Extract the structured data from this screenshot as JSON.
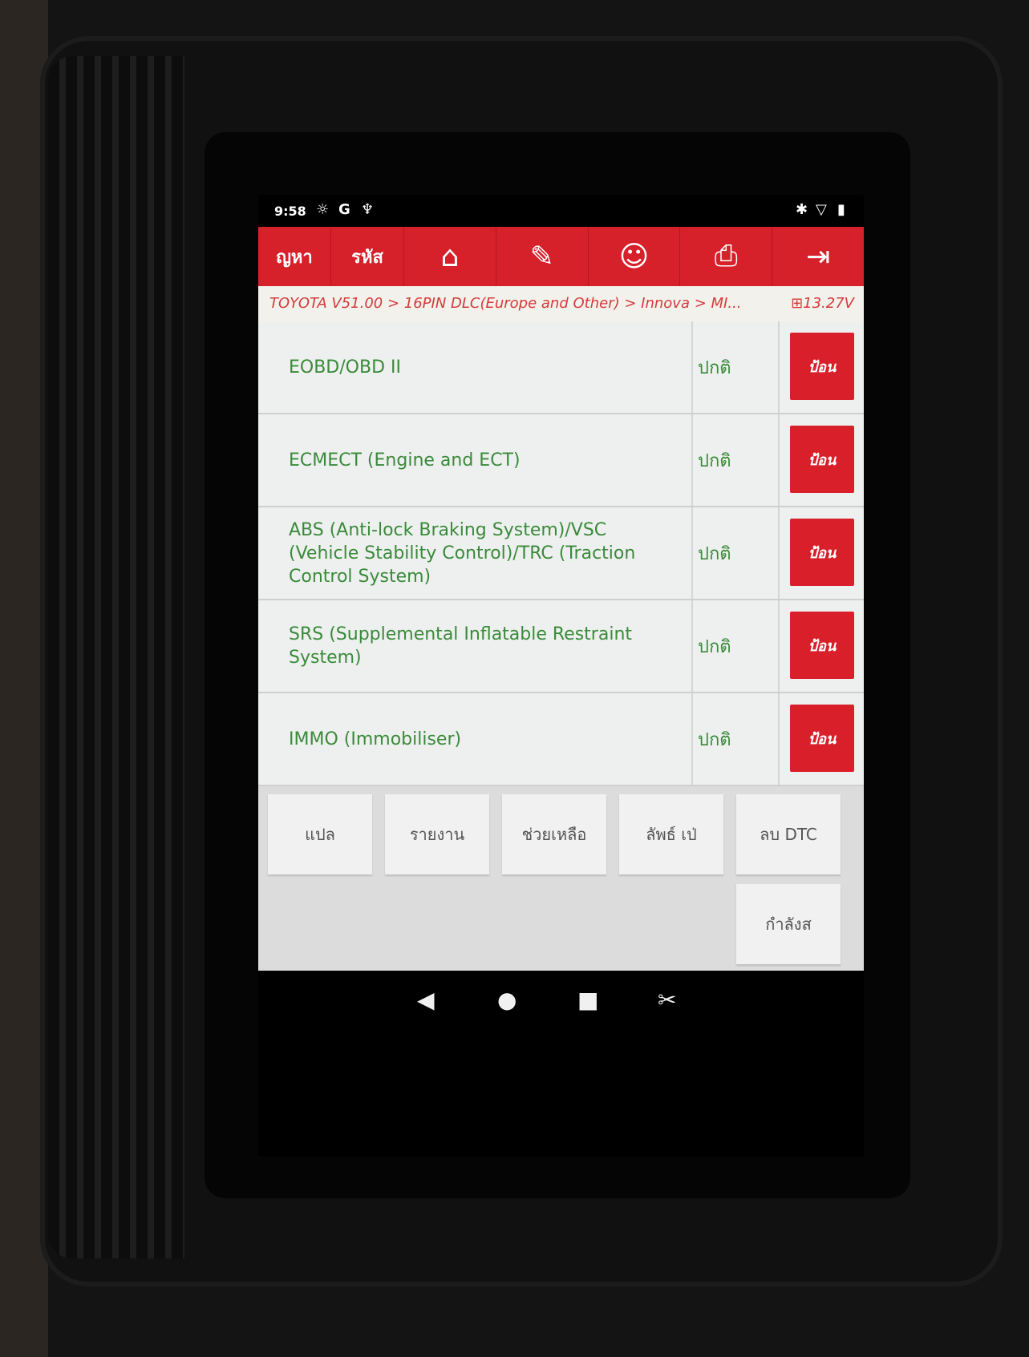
{
  "status_bar": {
    "time": "9:58",
    "icons": [
      "brightness-icon",
      "google-icon",
      "stethoscope-icon",
      "bluetooth-icon",
      "wifi-icon",
      "battery-icon"
    ]
  },
  "toolbar": {
    "item1": "ญหา",
    "item2": "รหัส",
    "icons": [
      "home-icon",
      "edit-icon",
      "support-icon",
      "print-icon",
      "exit-icon"
    ]
  },
  "breadcrumb": "TOYOTA V51.00 > 16PIN DLC(Europe and Other) > Innova > MI...",
  "voltage": "13.27V",
  "systems": [
    {
      "name": "EOBD/OBD II",
      "status": "ปกติ",
      "button": "ป้อน"
    },
    {
      "name": "ECMECT (Engine and ECT)",
      "status": "ปกติ",
      "button": "ป้อน"
    },
    {
      "name": "ABS (Anti-lock Braking System)/VSC (Vehicle Stability Control)/TRC (Traction Control System)",
      "status": "ปกติ",
      "button": "ป้อน"
    },
    {
      "name": "SRS (Supplemental Inflatable Restraint System)",
      "status": "ปกติ",
      "button": "ป้อน"
    },
    {
      "name": "IMMO (Immobiliser)",
      "status": "ปกติ",
      "button": "ป้อน"
    }
  ],
  "functions": {
    "translate": "แปล",
    "report": "รายงาน",
    "help": "ช่วยเหลือ",
    "compare": "ลัพธ์ เป่",
    "clear_dtc": "ลบ DTC",
    "power": "กำลังส"
  },
  "nav": {
    "back": "◀",
    "home": "●",
    "recent": "■",
    "screenshot": "✂"
  }
}
